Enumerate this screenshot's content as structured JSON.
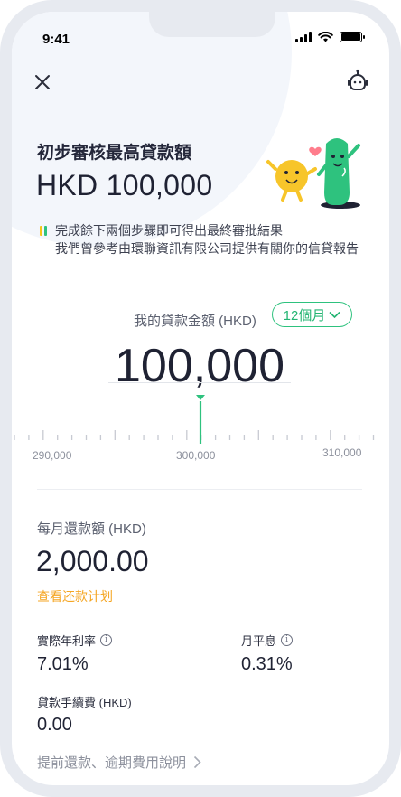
{
  "status_bar": {
    "time": "9:41"
  },
  "header": {
    "close_icon": "close-icon",
    "support_icon": "support-robot-icon"
  },
  "approval": {
    "title": "初步審核最高貸款額",
    "amount": "HKD 100,000",
    "notice_lines": [
      "完成餘下兩個步驟即可得出最終審批結果",
      "我們曾參考由環聯資訊有限公司提供有關你的信貸報告"
    ],
    "notice_bar_colors": [
      "#f5c518",
      "#2ec27e"
    ]
  },
  "loan": {
    "amount_label": "我的貸款金額 (HKD)",
    "term": "12個月",
    "amount": "100,000",
    "ruler_labels": [
      "290,000",
      "300,000",
      "310,000"
    ]
  },
  "repayment": {
    "monthly_label": "每月還款額 (HKD)",
    "monthly_value": "2,000.00",
    "plan_link": "查看还款计划",
    "apr_label": "實際年利率",
    "apr_value": "7.01%",
    "monthly_rate_label": "月平息",
    "monthly_rate_value": "0.31%",
    "fee_label": "貸款手續費 (HKD)",
    "fee_value": "0.00",
    "explain_link": "提前還款、逾期費用說明"
  },
  "colors": {
    "accent_green": "#2ec27e",
    "accent_orange": "#f5a623",
    "mascot_yellow": "#f7c52a"
  }
}
